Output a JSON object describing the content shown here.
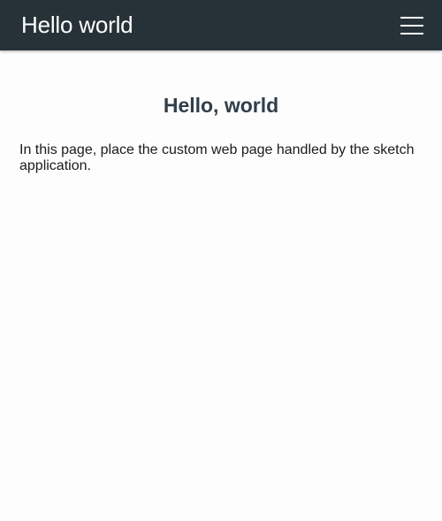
{
  "header": {
    "title": "Hello world",
    "menu_icon": "hamburger-menu-icon",
    "background_color": "#263238"
  },
  "main": {
    "heading": "Hello, world",
    "body_text": "In this page, place the custom web page handled by the sketch application."
  }
}
